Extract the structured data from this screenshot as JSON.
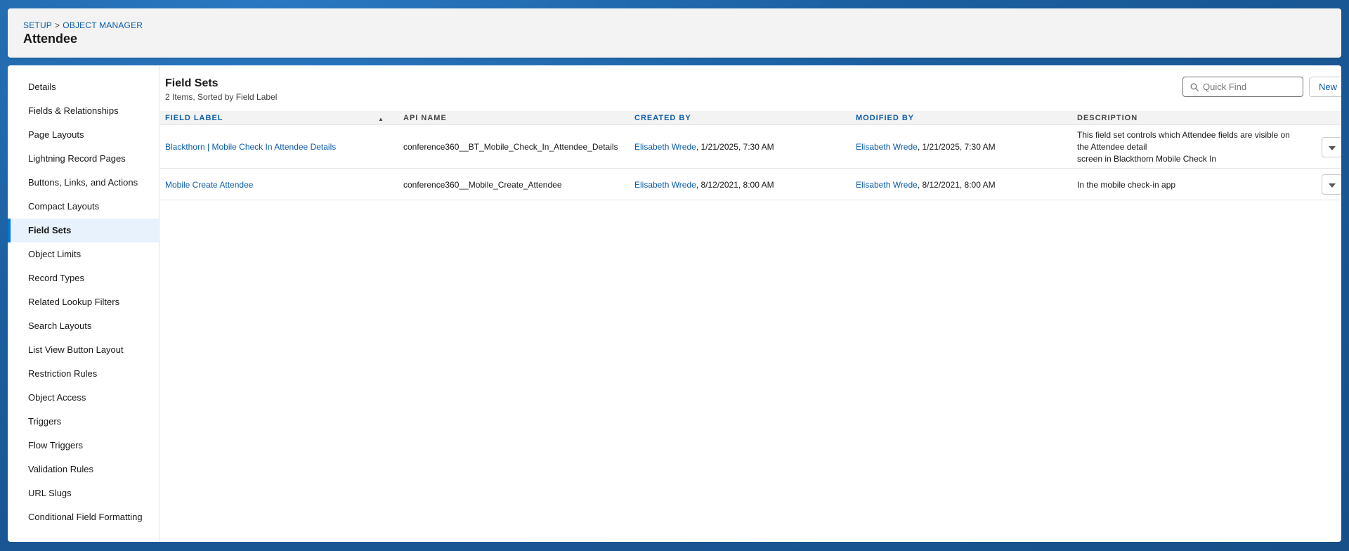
{
  "header": {
    "breadcrumb": [
      {
        "label": "SETUP"
      },
      {
        "label": "OBJECT MANAGER"
      }
    ],
    "breadcrumb_separator": ">",
    "title": "Attendee"
  },
  "sidebar": {
    "active": "Field Sets",
    "items": [
      {
        "label": "Details"
      },
      {
        "label": "Fields & Relationships"
      },
      {
        "label": "Page Layouts"
      },
      {
        "label": "Lightning Record Pages"
      },
      {
        "label": "Buttons, Links, and Actions"
      },
      {
        "label": "Compact Layouts"
      },
      {
        "label": "Field Sets"
      },
      {
        "label": "Object Limits"
      },
      {
        "label": "Record Types"
      },
      {
        "label": "Related Lookup Filters"
      },
      {
        "label": "Search Layouts"
      },
      {
        "label": "List View Button Layout"
      },
      {
        "label": "Restriction Rules"
      },
      {
        "label": "Object Access"
      },
      {
        "label": "Triggers"
      },
      {
        "label": "Flow Triggers"
      },
      {
        "label": "Validation Rules"
      },
      {
        "label": "URL Slugs"
      },
      {
        "label": "Conditional Field Formatting"
      }
    ]
  },
  "main": {
    "title": "Field Sets",
    "subtitle": "2 Items, Sorted by Field Label",
    "search": {
      "placeholder": "Quick Find",
      "value": "",
      "icon": "search-icon"
    },
    "new_label": "New",
    "columns": {
      "field_label": "FIELD LABEL",
      "api_name": "API NAME",
      "created_by": "CREATED BY",
      "modified_by": "MODIFIED BY",
      "description": "DESCRIPTION"
    },
    "sort_indicator": "▲",
    "rows": [
      {
        "field_label": "Blackthorn | Mobile Check In Attendee Details",
        "api_name": "conference360__BT_Mobile_Check_In_Attendee_Details",
        "created_by_user": "Elisabeth Wrede",
        "created_by_date": ", 1/21/2025, 7:30 AM",
        "modified_by_user": "Elisabeth Wrede",
        "modified_by_date": ", 1/21/2025, 7:30 AM",
        "description_lines": [
          "This field set controls which Attendee fields are visible on",
          "the Attendee detail",
          "screen in Blackthorn Mobile Check In"
        ]
      },
      {
        "field_label": "Mobile Create Attendee",
        "api_name": "conference360__Mobile_Create_Attendee",
        "created_by_user": "Elisabeth Wrede",
        "created_by_date": ", 8/12/2021, 8:00 AM",
        "modified_by_user": "Elisabeth Wrede",
        "modified_by_date": ", 8/12/2021, 8:00 AM",
        "description_lines": [
          "In the mobile check-in app"
        ]
      }
    ]
  },
  "colors": {
    "link": "#0b5cab",
    "active_accent": "#0176d3",
    "active_bg": "#e8f2fd",
    "background_blue": "#1b5fa0"
  }
}
